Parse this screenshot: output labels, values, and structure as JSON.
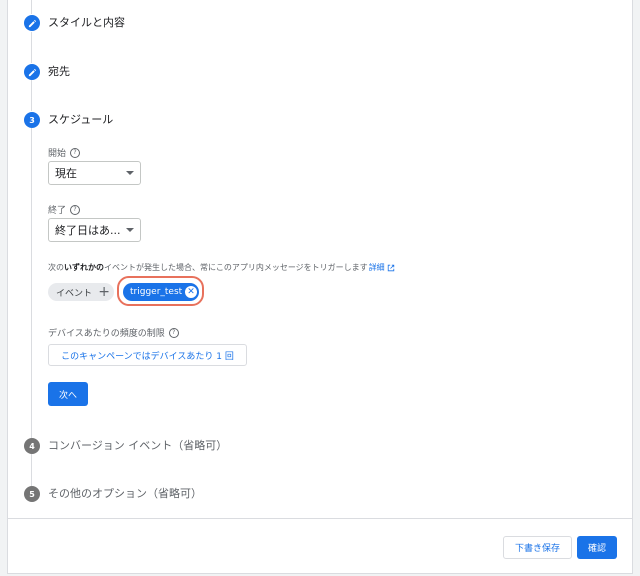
{
  "steps": [
    {
      "number": "",
      "title": "スタイルと内容",
      "state": "done",
      "icon": "pencil-icon"
    },
    {
      "number": "",
      "title": "宛先",
      "state": "done",
      "icon": "pencil-icon"
    },
    {
      "number": "3",
      "title": "スケジュール",
      "state": "active"
    },
    {
      "number": "4",
      "title": "コンバージョン イベント（省略可）",
      "state": "inactive"
    },
    {
      "number": "5",
      "title": "その他のオプション（省略可）",
      "state": "inactive"
    }
  ],
  "schedule": {
    "start_label": "開始",
    "start_value": "現在",
    "end_label": "終了",
    "end_value": "終了日はあ...",
    "desc_prefix": "次の",
    "desc_bold": "いずれかの",
    "desc_suffix": "イベントが発生した場合、常にこのアプリ内メッセージをトリガーします",
    "desc_link": "詳細",
    "event_chip_label": "イベント",
    "trigger_chip_label": "trigger_test",
    "frequency_label": "デバイスあたりの頻度の制限",
    "frequency_button": "このキャンペーンではデバイスあたり 1 回",
    "next_button": "次へ"
  },
  "footer": {
    "draft_button": "下書き保存",
    "confirm_button": "確認"
  },
  "colors": {
    "accent": "#1a73e8",
    "highlight": "#e8715c",
    "inactive_step": "#757575"
  }
}
